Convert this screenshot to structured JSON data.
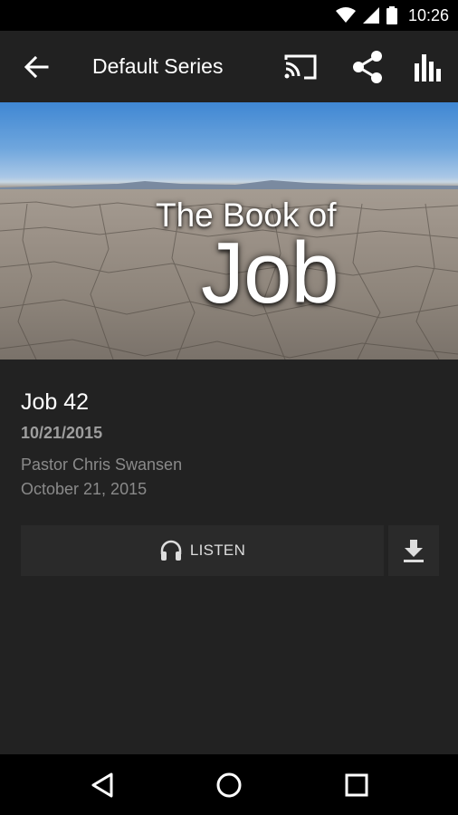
{
  "status_bar": {
    "time": "10:26",
    "icons": [
      "wifi-icon",
      "cell-signal-icon",
      "battery-icon"
    ]
  },
  "app_bar": {
    "title": "Default Series",
    "icons": [
      "back-arrow-icon",
      "cast-icon",
      "share-icon",
      "stats-icon"
    ]
  },
  "hero": {
    "line1": "The Book of",
    "line2": "Job"
  },
  "sermon": {
    "title": "Job 42",
    "date": "10/21/2015",
    "speaker": "Pastor Chris Swansen",
    "long_date": "October 21, 2015"
  },
  "actions": {
    "listen_label": "LISTEN",
    "listen_icon": "headphones-icon",
    "download_icon": "download-icon"
  },
  "nav_bar": {
    "icons": [
      "back-triangle-icon",
      "home-circle-icon",
      "recents-square-icon"
    ]
  },
  "colors": {
    "app_bar": "#212121",
    "background": "#222222",
    "button": "#2a2a2a",
    "muted_text": "#8a8a8a"
  }
}
